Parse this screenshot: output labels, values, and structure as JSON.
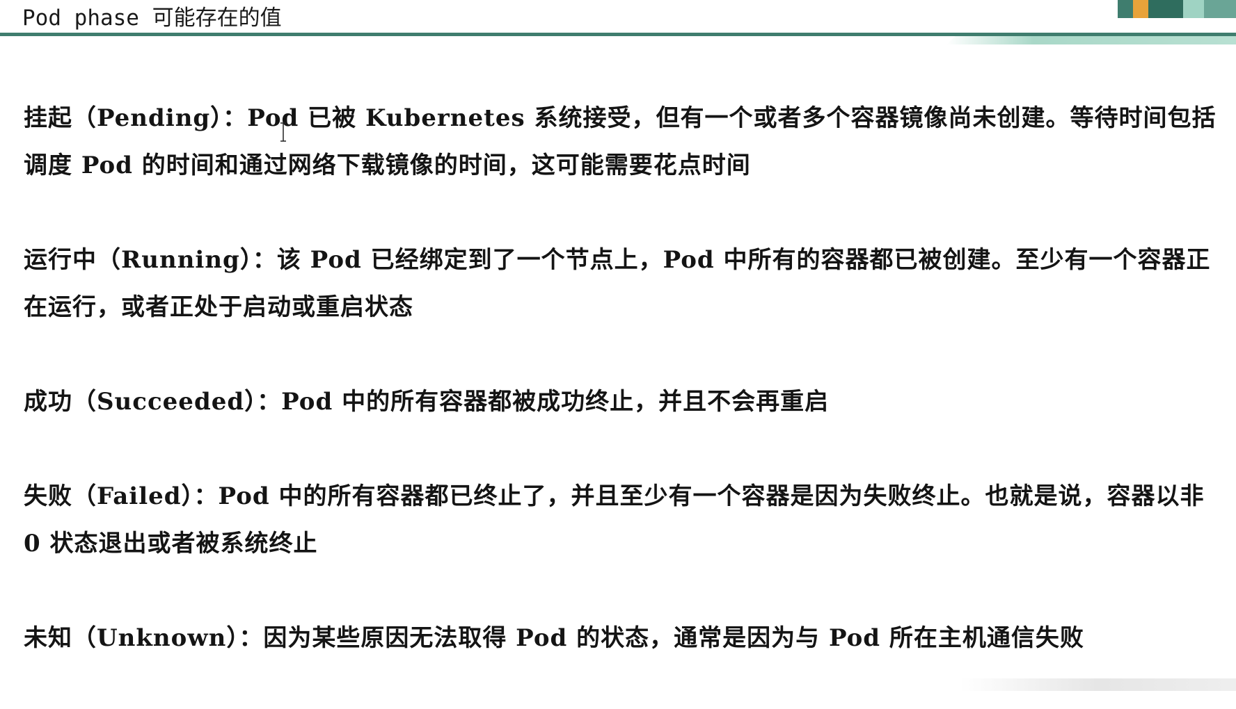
{
  "header": {
    "title": "Pod phase 可能存在的值"
  },
  "phases": [
    {
      "term": "挂起（Pending）：",
      "description": "Pod 已被 Kubernetes 系统接受，但有一个或者多个容器镜像尚未创建。等待时间包括调度 Pod 的时间和通过网络下载镜像的时间，这可能需要花点时间"
    },
    {
      "term": "运行中（Running）：",
      "description": "该 Pod 已经绑定到了一个节点上，Pod 中所有的容器都已被创建。至少有一个容器正在运行，或者正处于启动或重启状态"
    },
    {
      "term": "成功（Succeeded）：",
      "description": "Pod 中的所有容器都被成功终止，并且不会再重启"
    },
    {
      "term": "失败（Failed）：",
      "description": "Pod 中的所有容器都已终止了，并且至少有一个容器是因为失败终止。也就是说，容器以非 0 状态退出或者被系统终止"
    },
    {
      "term": "未知（Unknown）：",
      "description": "因为某些原因无法取得 Pod 的状态，通常是因为与 Pod 所在主机通信失败"
    }
  ],
  "colors": {
    "header_rule": "#3f7d6e",
    "header_accent": "#b8e0d2",
    "text": "#141414"
  },
  "icons": {
    "cursor": "text-cursor-icon"
  }
}
